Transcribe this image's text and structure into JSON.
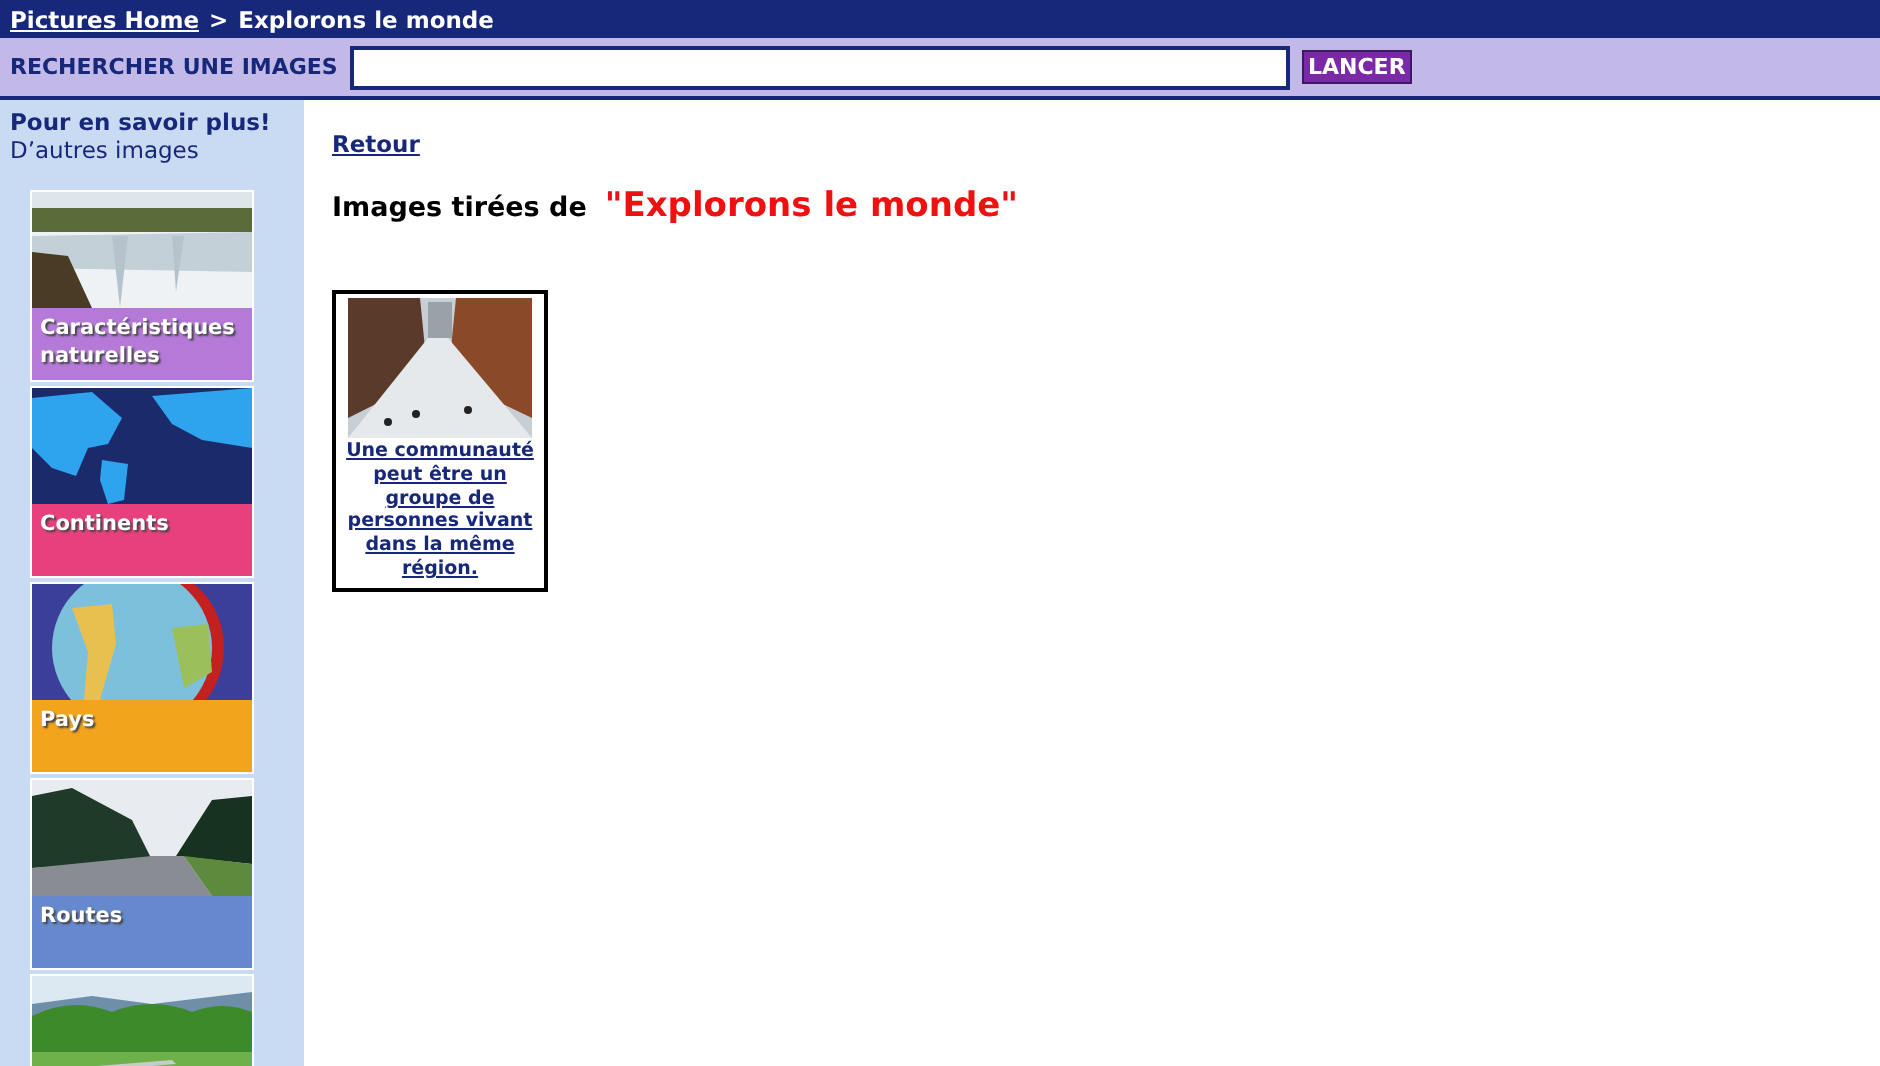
{
  "breadcrumb": {
    "home": "Pictures Home",
    "separator": ">",
    "current": "Explorons le monde"
  },
  "search": {
    "label": "RECHERCHER UNE IMAGES",
    "button": "LANCER"
  },
  "sidebar": {
    "title": "Pour en savoir plus!",
    "subtitle": "D’autres images",
    "items": [
      {
        "kind": "tile",
        "label": "Caractéristiques naturelles",
        "color": "#b57ad8"
      },
      {
        "kind": "tile",
        "label": "Continents",
        "color": "#e8407c"
      },
      {
        "kind": "tile",
        "label": "Pays",
        "color": "#f2a41c"
      },
      {
        "kind": "tile",
        "label": "Routes",
        "color": "#6688cc"
      },
      {
        "kind": "picture"
      }
    ]
  },
  "back_link": "Retour",
  "heading": {
    "prefix": "Images tirées de",
    "title": "\"Explorons le monde\""
  },
  "results": [
    {
      "caption": "Une communauté peut être un groupe de personnes vivant dans la même région."
    }
  ]
}
